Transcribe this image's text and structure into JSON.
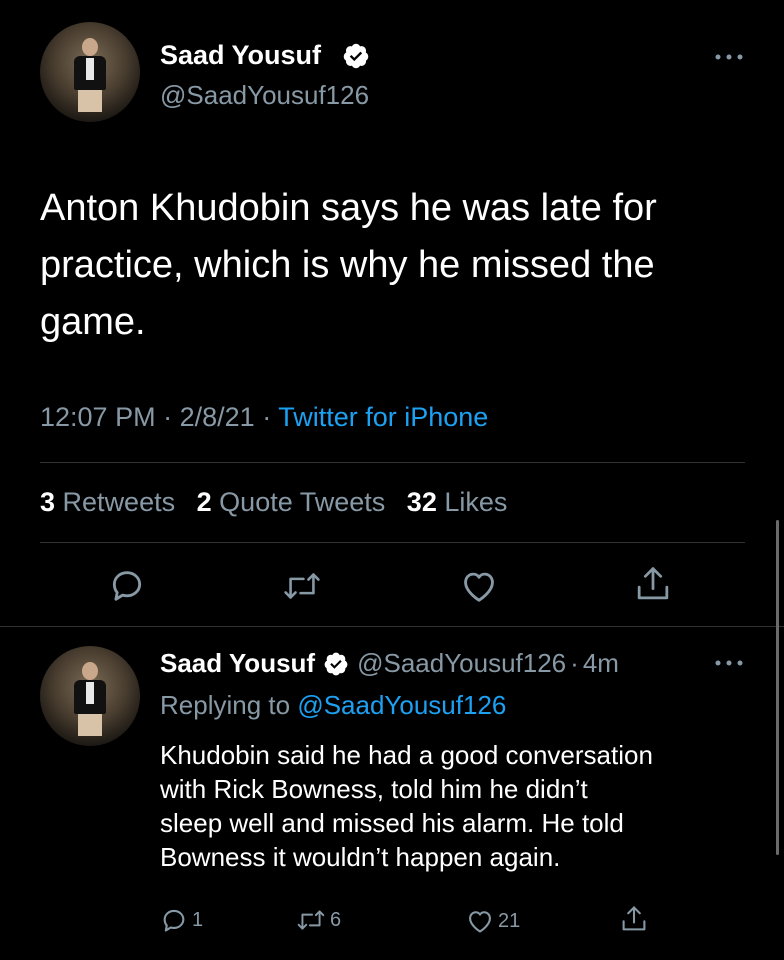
{
  "main_tweet": {
    "author_name": "Saad Yousuf",
    "author_handle": "@SaadYousuf126",
    "text_lines": [
      "Anton Khudobin says he was late for",
      "practice, which is why he missed the",
      "game."
    ],
    "time": "12:07 PM",
    "date": "2/8/21",
    "separator": "·",
    "source": "Twitter for iPhone",
    "stats": {
      "retweets_count": "3",
      "retweets_label": "Retweets",
      "quotes_count": "2",
      "quotes_label": "Quote Tweets",
      "likes_count": "32",
      "likes_label": "Likes"
    }
  },
  "reply_tweet": {
    "author_name": "Saad Yousuf",
    "author_handle": "@SaadYousuf126",
    "time_ago": "4m",
    "separator": "·",
    "replying_prefix": "Replying to",
    "replying_handle": "@SaadYousuf126",
    "text_lines": [
      "Khudobin said he had a good conversation",
      "with Rick Bowness, told him he didn’t",
      "sleep well and missed his alarm. He told",
      "Bowness it wouldn’t happen again."
    ],
    "reply_count": "1",
    "retweet_count": "6",
    "like_count": "21"
  },
  "icons": [
    "verified-badge-icon",
    "more-icon",
    "reply-icon",
    "retweet-icon",
    "like-icon",
    "share-icon"
  ],
  "colors": {
    "background": "#000000",
    "text": "#ffffff",
    "secondary": "#8899a6",
    "link": "#1da1f2",
    "divider": "#2f3336"
  }
}
